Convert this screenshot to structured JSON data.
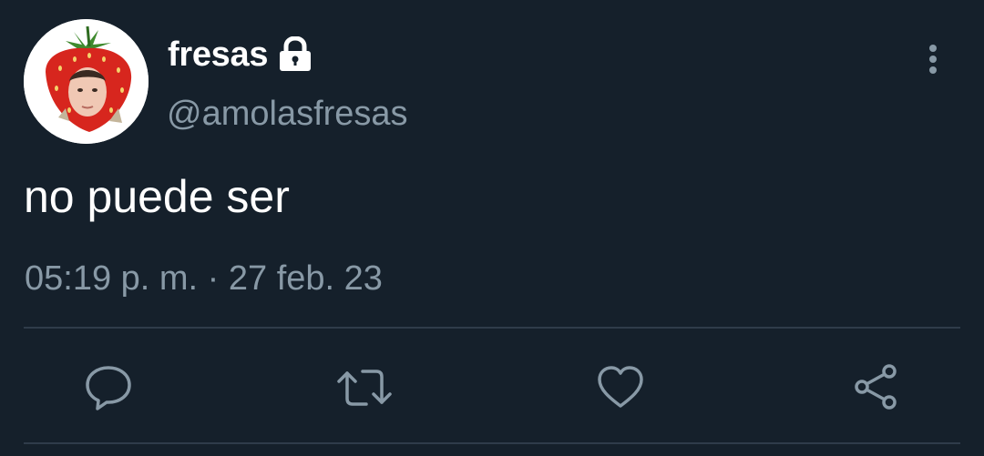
{
  "tweet": {
    "display_name": "fresas",
    "handle": "@amolasfresas",
    "text": "no puede ser",
    "timestamp": "05:19 p. m. · 27 feb. 23",
    "protected": true
  },
  "icons": {
    "lock": "lock-icon",
    "more": "more-vertical-icon",
    "reply": "reply-icon",
    "retweet": "retweet-icon",
    "like": "heart-icon",
    "share": "share-icon"
  },
  "colors": {
    "background": "#15202b",
    "primary_text": "#ffffff",
    "secondary_text": "#8899a6",
    "divider": "#2f3c4a",
    "action_icon": "#8899a6"
  }
}
